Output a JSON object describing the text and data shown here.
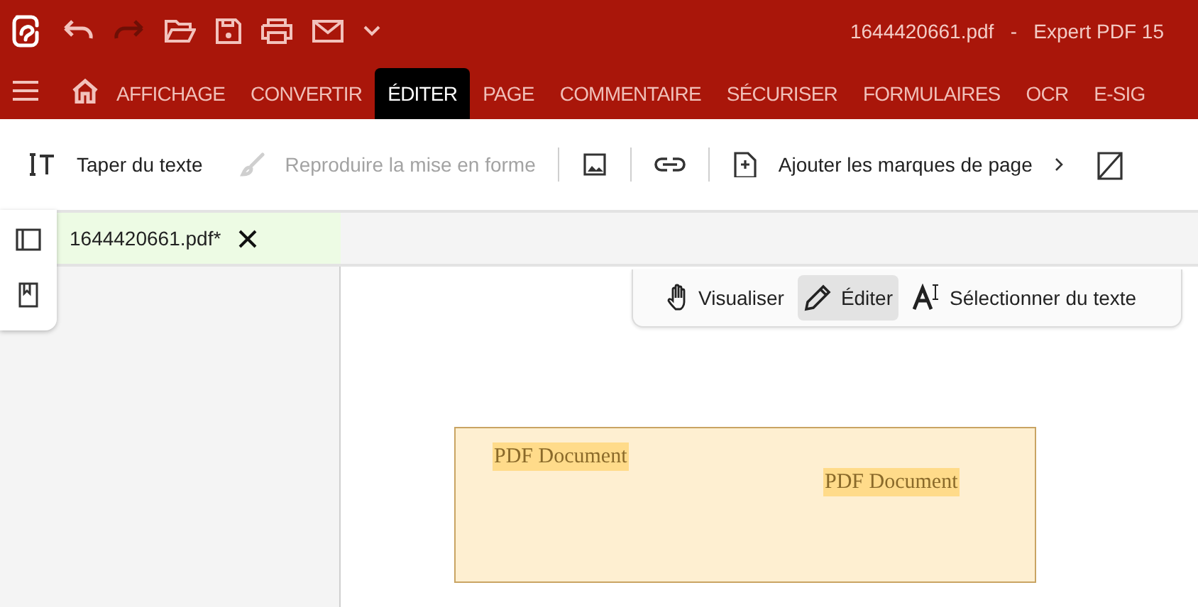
{
  "window": {
    "title": "1644420661.pdf   -   Expert PDF 15"
  },
  "ribbon_tabs": [
    {
      "label": "AFFICHAGE",
      "selected": false
    },
    {
      "label": "CONVERTIR",
      "selected": false
    },
    {
      "label": "ÉDITER",
      "selected": true
    },
    {
      "label": "PAGE",
      "selected": false
    },
    {
      "label": "COMMENTAIRE",
      "selected": false
    },
    {
      "label": "SÉCURISER",
      "selected": false
    },
    {
      "label": "FORMULAIRES",
      "selected": false
    },
    {
      "label": "OCR",
      "selected": false
    },
    {
      "label": "E-SIG",
      "selected": false
    }
  ],
  "toolbar": [
    {
      "kind": "text-tool",
      "label": "Taper du texte",
      "disabled": false
    },
    {
      "kind": "format-painter",
      "label": "Reproduire la mise en forme",
      "disabled": true
    },
    {
      "kind": "image",
      "disabled": false
    },
    {
      "kind": "link",
      "disabled": false
    },
    {
      "kind": "bookmark",
      "label": "Ajouter les marques de page",
      "disabled": false
    }
  ],
  "document_tab": {
    "label": "1644420661.pdf*"
  },
  "view_modes": [
    {
      "kind": "hand",
      "label": "Visualiser",
      "selected": false
    },
    {
      "kind": "pencil",
      "label": "Éditer",
      "selected": true
    },
    {
      "kind": "select-text",
      "label": "Sélectionner du texte",
      "selected": false
    }
  ],
  "page": {
    "texts": [
      "PDF Document",
      "PDF Document"
    ]
  }
}
